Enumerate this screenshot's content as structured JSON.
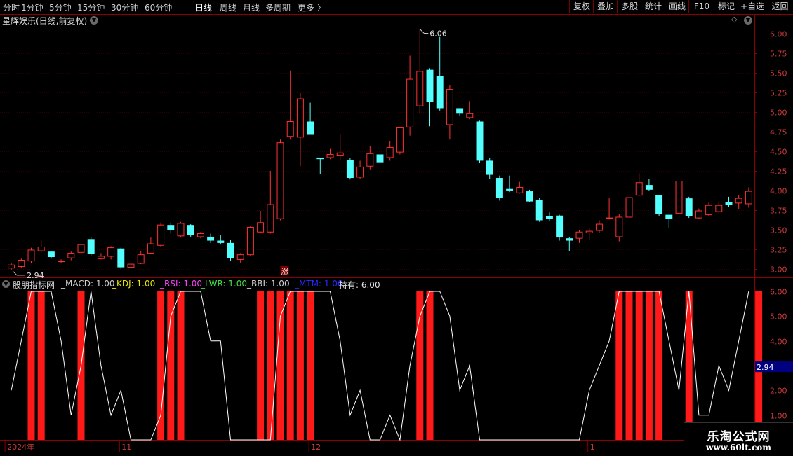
{
  "toolbar": {
    "periods": [
      "分时",
      "1分钟",
      "5分钟",
      "15分钟",
      "30分钟",
      "60分钟",
      "日线",
      "周线",
      "月线",
      "多周期",
      "更多 〉"
    ],
    "active_period": "日线",
    "right_buttons": [
      "复权",
      "叠加",
      "多股",
      "统计",
      "画线",
      "F10",
      "标记",
      "+自选",
      "返回"
    ]
  },
  "chart_title": "星辉娱乐(日线,前复权)",
  "price_axis": {
    "ticks": [
      "6.00",
      "5.75",
      "5.50",
      "5.25",
      "5.00",
      "4.75",
      "4.50",
      "4.25",
      "4.00",
      "3.75",
      "3.50",
      "3.25",
      "3.00"
    ]
  },
  "high_label": "6.06",
  "low_label": "2.94",
  "zhang_label": "涨",
  "indicator": {
    "name": "股朋指标网",
    "items": [
      {
        "label": "_MACD: 1.00",
        "color": "#d0d0d0"
      },
      {
        "label": "_KDJ: 1.00",
        "color": "#e8e800"
      },
      {
        "label": "_RSI: 1.00",
        "color": "#ff40ff"
      },
      {
        "label": "_LWR: 1.00",
        "color": "#40e040"
      },
      {
        "label": "_BBI: 1.00",
        "color": "#d0d0d0"
      },
      {
        "label": "_MTM: 1.00",
        "color": "#2828ff"
      },
      {
        "label": "持有: 6.00",
        "color": "#e0e0e0"
      }
    ],
    "axis_ticks": [
      "6.00",
      "5.00",
      "4.00",
      "3.00",
      "2.00",
      "1.00"
    ],
    "highlight_value": "2.94"
  },
  "date_axis": [
    "2024年",
    "11",
    "12",
    "1"
  ],
  "watermark": {
    "line1": "乐淘公式网",
    "line2": "www.60lt.com"
  },
  "colors": {
    "up": "#ff3232",
    "down": "#54ffff",
    "frame": "#8b0000",
    "bar": "#ff1a1a",
    "line": "#ffffff"
  },
  "chart_data": {
    "type": "candlestick",
    "candles": [
      [
        3.01,
        3.05,
        3.07,
        2.99
      ],
      [
        3.03,
        3.11,
        3.13,
        3.01
      ],
      [
        3.1,
        3.24,
        3.27,
        3.07
      ],
      [
        3.23,
        3.28,
        3.36,
        3.21
      ],
      [
        3.22,
        3.15,
        3.23,
        3.13
      ],
      [
        3.1,
        3.1,
        3.12,
        3.08
      ],
      [
        3.14,
        3.2,
        3.22,
        3.11
      ],
      [
        3.21,
        3.31,
        3.32,
        3.18
      ],
      [
        3.38,
        3.19,
        3.4,
        3.17
      ],
      [
        3.13,
        3.16,
        3.2,
        3.12
      ],
      [
        3.16,
        3.27,
        3.29,
        3.12
      ],
      [
        3.26,
        3.02,
        3.27,
        3.0
      ],
      [
        3.02,
        3.06,
        3.07,
        3.01
      ],
      [
        3.07,
        3.18,
        3.23,
        3.06
      ],
      [
        3.2,
        3.32,
        3.4,
        3.19
      ],
      [
        3.3,
        3.56,
        3.59,
        3.28
      ],
      [
        3.56,
        3.49,
        3.58,
        3.46
      ],
      [
        3.42,
        3.58,
        3.6,
        3.4
      ],
      [
        3.56,
        3.43,
        3.57,
        3.41
      ],
      [
        3.41,
        3.45,
        3.47,
        3.39
      ],
      [
        3.41,
        3.36,
        3.45,
        3.33
      ],
      [
        3.36,
        3.33,
        3.43,
        3.31
      ],
      [
        3.33,
        3.14,
        3.37,
        3.1
      ],
      [
        3.12,
        3.18,
        3.2,
        3.07
      ],
      [
        3.18,
        3.53,
        3.55,
        3.16
      ],
      [
        3.47,
        3.59,
        3.74,
        3.46
      ],
      [
        3.47,
        3.82,
        4.25,
        3.45
      ],
      [
        3.64,
        4.61,
        4.65,
        3.62
      ],
      [
        4.69,
        4.88,
        5.53,
        4.65
      ],
      [
        4.68,
        5.17,
        5.24,
        4.31
      ],
      [
        4.88,
        4.71,
        5.12,
        4.72
      ],
      [
        4.42,
        4.4,
        4.41,
        4.21
      ],
      [
        4.42,
        4.46,
        4.53,
        4.4
      ],
      [
        4.45,
        4.48,
        4.72,
        4.38
      ],
      [
        4.39,
        4.16,
        4.41,
        4.14
      ],
      [
        4.17,
        4.3,
        4.38,
        4.15
      ],
      [
        4.31,
        4.47,
        4.57,
        4.27
      ],
      [
        4.46,
        4.36,
        4.51,
        4.32
      ],
      [
        4.42,
        4.55,
        4.63,
        4.38
      ],
      [
        4.49,
        4.8,
        4.81,
        4.46
      ],
      [
        4.81,
        5.42,
        5.72,
        4.7
      ],
      [
        5.08,
        5.52,
        6.06,
        4.98
      ],
      [
        5.54,
        5.13,
        5.56,
        4.82
      ],
      [
        5.46,
        5.05,
        5.96,
        5.02
      ],
      [
        4.84,
        5.29,
        5.34,
        4.65
      ],
      [
        5.05,
        4.98,
        5.05,
        4.95
      ],
      [
        4.93,
        4.98,
        5.14,
        4.91
      ],
      [
        4.88,
        4.38,
        4.89,
        4.35
      ],
      [
        4.38,
        4.2,
        4.42,
        4.15
      ],
      [
        4.16,
        3.91,
        4.19,
        3.87
      ],
      [
        4.02,
        4.0,
        4.19,
        3.98
      ],
      [
        3.97,
        4.04,
        4.11,
        3.96
      ],
      [
        3.99,
        3.86,
        4.01,
        3.85
      ],
      [
        3.88,
        3.62,
        3.91,
        3.6
      ],
      [
        3.67,
        3.64,
        3.72,
        3.61
      ],
      [
        3.68,
        3.4,
        3.69,
        3.36
      ],
      [
        3.39,
        3.36,
        3.41,
        3.23
      ],
      [
        3.39,
        3.47,
        3.49,
        3.33
      ],
      [
        3.46,
        3.48,
        3.52,
        3.36
      ],
      [
        3.49,
        3.57,
        3.62,
        3.46
      ],
      [
        3.65,
        3.65,
        3.9,
        3.63
      ],
      [
        3.41,
        3.66,
        3.7,
        3.35
      ],
      [
        3.66,
        3.91,
        3.92,
        3.6
      ],
      [
        3.94,
        4.1,
        4.22,
        3.93
      ],
      [
        4.07,
        4.01,
        4.15,
        4.0
      ],
      [
        3.94,
        3.7,
        3.94,
        3.67
      ],
      [
        3.69,
        3.64,
        3.69,
        3.52
      ],
      [
        3.71,
        4.12,
        4.34,
        3.69
      ],
      [
        3.9,
        3.67,
        3.92,
        3.65
      ],
      [
        3.65,
        3.74,
        3.77,
        3.64
      ],
      [
        3.69,
        3.81,
        3.85,
        3.67
      ],
      [
        3.73,
        3.81,
        3.86,
        3.71
      ],
      [
        3.85,
        3.82,
        3.92,
        3.79
      ],
      [
        3.84,
        3.9,
        3.94,
        3.76
      ],
      [
        3.83,
        3.99,
        4.04,
        3.78
      ]
    ],
    "indicator_line": [
      2,
      4,
      6,
      6,
      6,
      4,
      1,
      3,
      6,
      3,
      1,
      2,
      0,
      0,
      0,
      1,
      5,
      6,
      6,
      6,
      4,
      4,
      0,
      0,
      0,
      0,
      0,
      5,
      6,
      6,
      6,
      6,
      6,
      4,
      1,
      2,
      0,
      0,
      1,
      0,
      3,
      5,
      6,
      6,
      5,
      2,
      3,
      0,
      0,
      0,
      0,
      0,
      0,
      0,
      0,
      0,
      0,
      0,
      2,
      3,
      4,
      6,
      6,
      6,
      6,
      6,
      4,
      2,
      6,
      1,
      1,
      3,
      2,
      4,
      6
    ],
    "signal_bars": [
      2,
      3,
      7,
      15,
      16,
      17,
      25,
      26,
      27,
      28,
      29,
      30,
      41,
      42,
      61,
      62,
      63,
      64,
      65,
      68,
      75
    ],
    "price_range": [
      2.9,
      6.1
    ],
    "indicator_range": [
      0,
      6
    ]
  }
}
